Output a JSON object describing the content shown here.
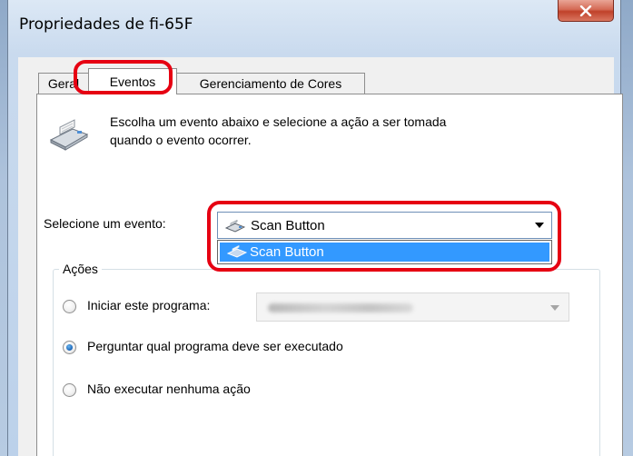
{
  "window": {
    "title": "Propriedades de fi-65F"
  },
  "tabs": [
    {
      "label": "Geral"
    },
    {
      "label": "Eventos"
    },
    {
      "label": "Gerenciamento de Cores"
    }
  ],
  "intro": {
    "line1": "Escolha um evento abaixo e selecione a ação a ser tomada",
    "line2": "quando o evento ocorrer."
  },
  "event": {
    "label": "Selecione um evento:",
    "selected": "Scan Button",
    "options": [
      "Scan Button"
    ]
  },
  "actions": {
    "legend": "Ações",
    "options": [
      {
        "label": "Iniciar este programa:",
        "checked": false
      },
      {
        "label": "Perguntar qual programa deve ser executado",
        "checked": true
      },
      {
        "label": "Não executar nenhuma ação",
        "checked": false
      }
    ]
  },
  "colors": {
    "annotation": "#e60012",
    "selection": "#3399ff",
    "close": "#c0412a"
  },
  "icons": {
    "close": "close-icon",
    "scanner": "scanner-icon",
    "scan_button": "scan-button-icon",
    "dropdown": "chevron-down-icon"
  }
}
